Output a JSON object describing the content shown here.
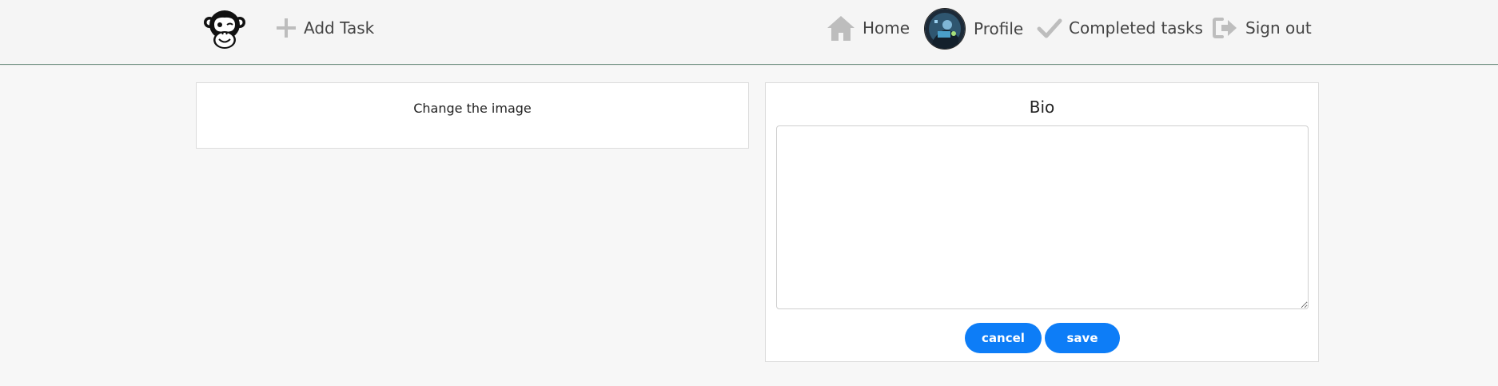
{
  "navbar": {
    "logo_icon": "winking-chimp-logo-icon",
    "add_task_label": "Add Task",
    "add_task_icon": "plus-icon",
    "home_label": "Home",
    "home_icon": "home-icon",
    "profile_label": "Profile",
    "profile_avatar": "user-avatar",
    "completed_label": "Completed tasks",
    "completed_icon": "checkmark-icon",
    "signout_label": "Sign out",
    "signout_icon": "sign-out-icon",
    "icon_color": "#bdbdbd"
  },
  "image_card": {
    "title": "Change the image"
  },
  "bio_card": {
    "title": "Bio",
    "textarea_value": "",
    "textarea_placeholder": "",
    "cancel_label": "cancel",
    "save_label": "save",
    "button_color": "#0d7df7"
  }
}
